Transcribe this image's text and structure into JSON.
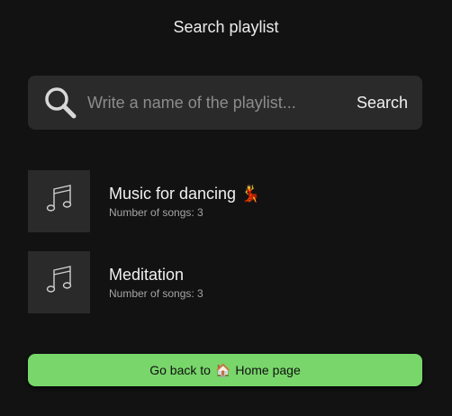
{
  "header": {
    "title": "Search playlist"
  },
  "search": {
    "placeholder": "Write a name of the playlist...",
    "value": "",
    "button_label": "Search",
    "icon": "search-icon"
  },
  "playlists": [
    {
      "name": "Music for dancing",
      "emoji": "💃",
      "count_text": "Number of songs: 3",
      "icon": "music-note-icon"
    },
    {
      "name": "Meditation",
      "emoji": "",
      "count_text": "Number of songs: 3",
      "icon": "music-note-icon"
    }
  ],
  "footer": {
    "home_button_prefix": "Go back to",
    "home_button_emoji": "🏠",
    "home_button_suffix": "Home page"
  },
  "colors": {
    "background": "#121212",
    "surface": "#2a2a2a",
    "accent": "#78d66a",
    "text_primary": "#f0f0f0",
    "text_secondary": "#a5a5a5",
    "placeholder": "#8c8c8c"
  }
}
